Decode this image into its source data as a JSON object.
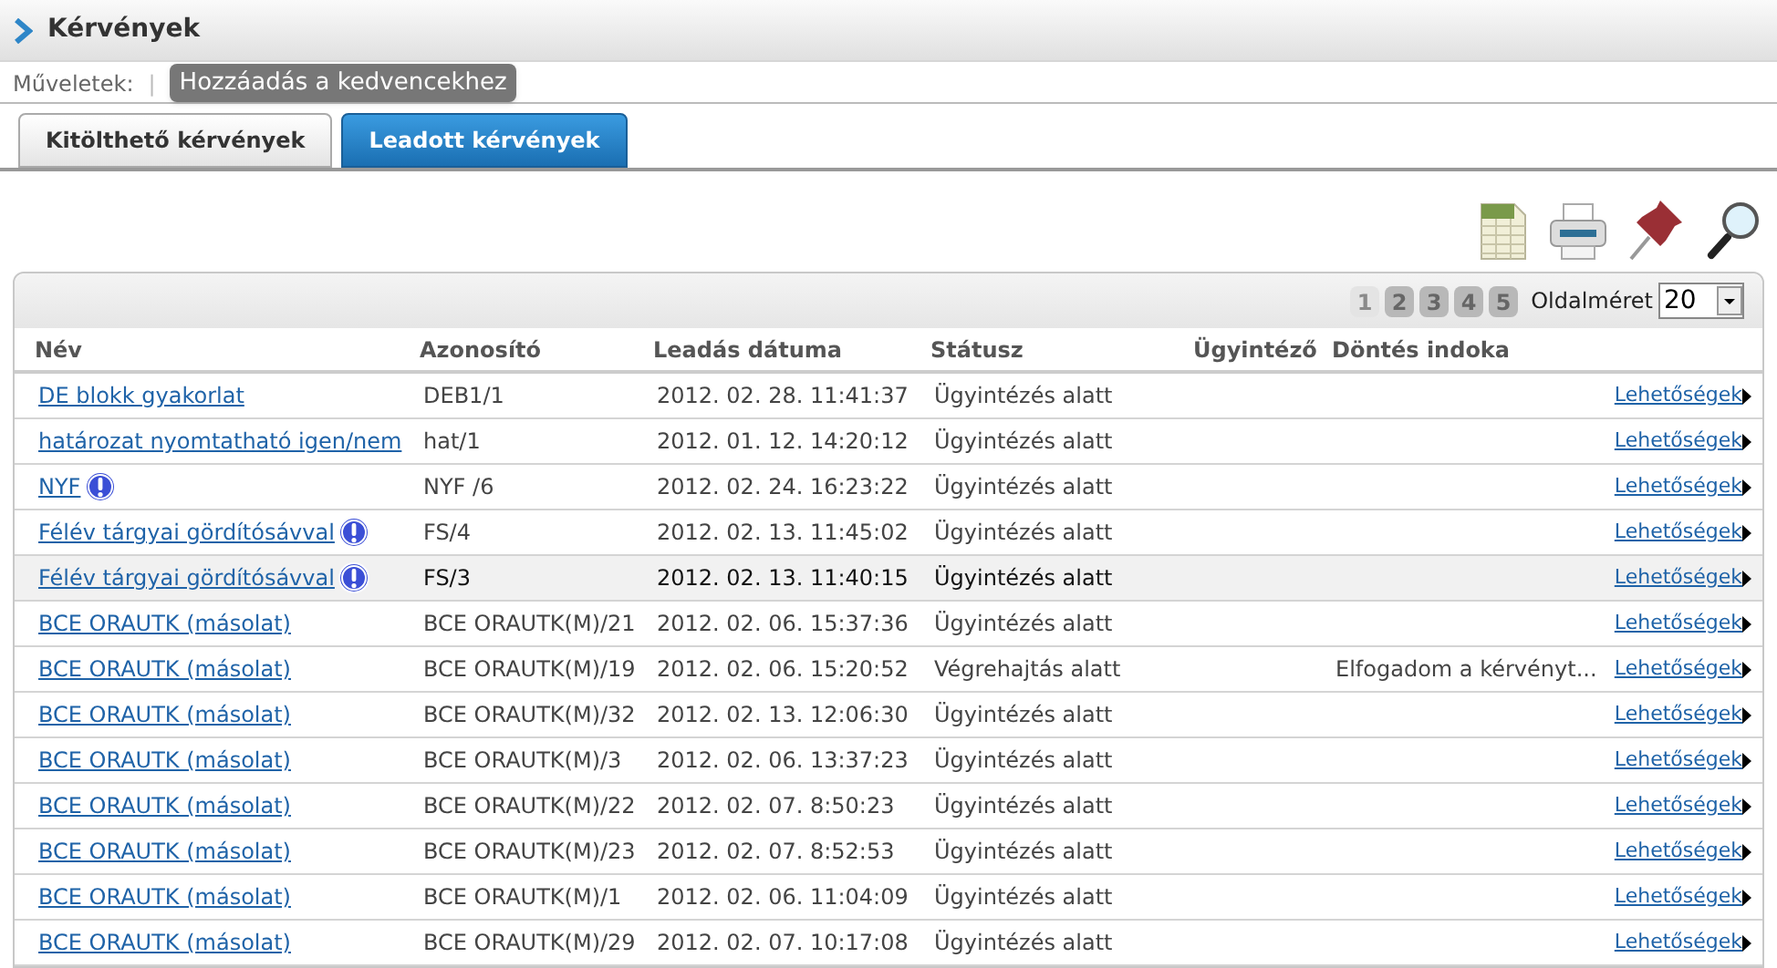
{
  "page_title": "Kérvények",
  "actions": {
    "label": "Műveletek:",
    "separator": "|",
    "buttons": [
      "Hozzáadás a kedvencekhez"
    ]
  },
  "tabs": [
    {
      "label": "Kitölthető kérvények",
      "selected": false
    },
    {
      "label": "Leadott kérvények",
      "selected": true
    }
  ],
  "toolbar": [
    {
      "kind": "xls"
    },
    {
      "kind": "print"
    },
    {
      "kind": "pin"
    },
    {
      "kind": "search"
    }
  ],
  "pager": {
    "pages": [
      {
        "label": "1",
        "selected": true
      },
      {
        "label": "2",
        "selected": false
      },
      {
        "label": "3",
        "selected": false
      },
      {
        "label": "4",
        "selected": false
      },
      {
        "label": "5",
        "selected": false
      }
    ],
    "page_size_label": "Oldalméret",
    "page_size": "20"
  },
  "table": {
    "columns": [
      "Név",
      "Azonosító",
      "Leadás dátuma",
      "Státusz",
      "Ügyintéző",
      "Döntés indoka"
    ],
    "rows": [
      {
        "name": "DE blokk gyakorlat",
        "alert": false,
        "id": "DEB1/1",
        "date": "2012. 02. 28. 11:41:37",
        "status": "Ügyintézés alatt",
        "reason": "",
        "action": "Lehetőségek",
        "selected": false
      },
      {
        "name": "határozat nyomtatható igen/nem",
        "alert": false,
        "id": "hat/1",
        "date": "2012. 01. 12. 14:20:12",
        "status": "Ügyintézés alatt",
        "reason": "",
        "action": "Lehetőségek",
        "selected": false
      },
      {
        "name": "NYF",
        "alert": true,
        "id": "NYF /6",
        "date": "2012. 02. 24. 16:23:22",
        "status": "Ügyintézés alatt",
        "reason": "",
        "action": "Lehetőségek",
        "selected": false
      },
      {
        "name": "Félév tárgyai gördítósávval",
        "alert": true,
        "id": "FS/4",
        "date": "2012. 02. 13. 11:45:02",
        "status": "Ügyintézés alatt",
        "reason": "",
        "action": "Lehetőségek",
        "selected": false
      },
      {
        "name": "Félév tárgyai gördítósávval",
        "alert": true,
        "id": "FS/3",
        "date": "2012. 02. 13. 11:40:15",
        "status": "Ügyintézés alatt",
        "reason": "",
        "action": "Lehetőségek",
        "selected": true
      },
      {
        "name": "BCE ORAUTK (másolat)",
        "alert": false,
        "id": "BCE ORAUTK(M)/21",
        "date": "2012. 02. 06. 15:37:36",
        "status": "Ügyintézés alatt",
        "reason": "",
        "action": "Lehetőségek",
        "selected": false
      },
      {
        "name": "BCE ORAUTK (másolat)",
        "alert": false,
        "id": "BCE ORAUTK(M)/19",
        "date": "2012. 02. 06. 15:20:52",
        "status": "Végrehajtás alatt",
        "reason": "Elfogadom a kérvényt...",
        "action": "Lehetőségek",
        "selected": false
      },
      {
        "name": "BCE ORAUTK (másolat)",
        "alert": false,
        "id": "BCE ORAUTK(M)/32",
        "date": "2012. 02. 13. 12:06:30",
        "status": "Ügyintézés alatt",
        "reason": "",
        "action": "Lehetőségek",
        "selected": false
      },
      {
        "name": "BCE ORAUTK (másolat)",
        "alert": false,
        "id": "BCE ORAUTK(M)/3",
        "date": "2012. 02. 06. 13:37:23",
        "status": "Ügyintézés alatt",
        "reason": "",
        "action": "Lehetőségek",
        "selected": false
      },
      {
        "name": "BCE ORAUTK (másolat)",
        "alert": false,
        "id": "BCE ORAUTK(M)/22",
        "date": "2012. 02. 07. 8:50:23",
        "status": "Ügyintézés alatt",
        "reason": "",
        "action": "Lehetőségek",
        "selected": false
      },
      {
        "name": "BCE ORAUTK (másolat)",
        "alert": false,
        "id": "BCE ORAUTK(M)/23",
        "date": "2012. 02. 07. 8:52:53",
        "status": "Ügyintézés alatt",
        "reason": "",
        "action": "Lehetőségek",
        "selected": false
      },
      {
        "name": "BCE ORAUTK (másolat)",
        "alert": false,
        "id": "BCE ORAUTK(M)/1",
        "date": "2012. 02. 06. 11:04:09",
        "status": "Ügyintézés alatt",
        "reason": "",
        "action": "Lehetőségek",
        "selected": false
      },
      {
        "name": "BCE ORAUTK (másolat)",
        "alert": false,
        "id": "BCE ORAUTK(M)/29",
        "date": "2012. 02. 07. 10:17:08",
        "status": "Ügyintézés alatt",
        "reason": "",
        "action": "Lehetőségek",
        "selected": false
      }
    ]
  }
}
